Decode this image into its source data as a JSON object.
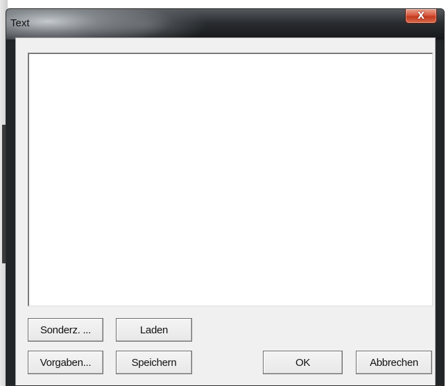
{
  "window": {
    "title": "Text",
    "close_glyph": "X",
    "accent_close": "#c8482c"
  },
  "dialog": {
    "text_value": "",
    "buttons": {
      "sonderz": "Sonderz. ...",
      "laden": "Laden",
      "vorgaben": "Vorgaben...",
      "speichern": "Speichern",
      "ok": "OK",
      "abbrechen": "Abbrechen"
    }
  }
}
